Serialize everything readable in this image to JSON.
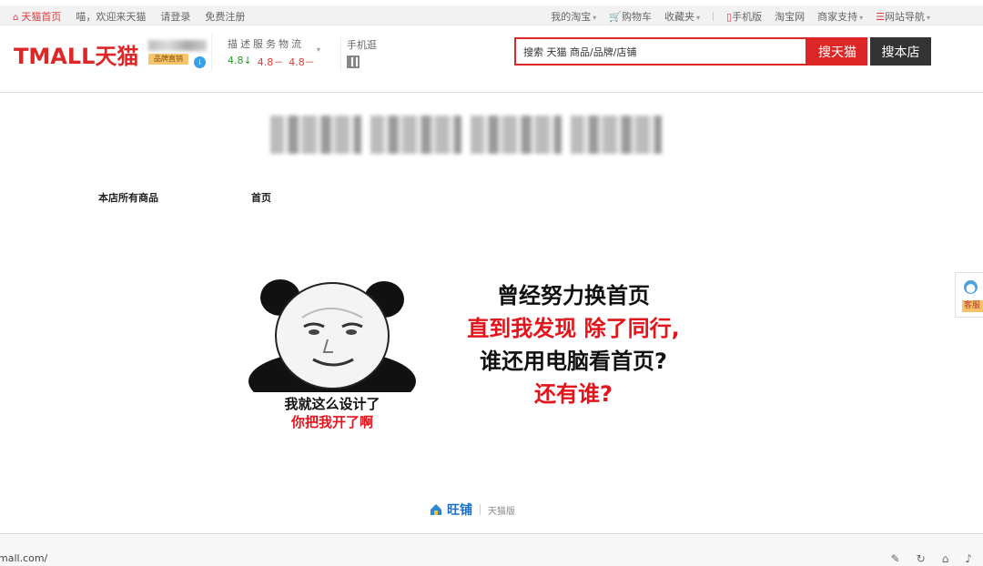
{
  "topnav": {
    "home": "天猫首页",
    "welcome": "喵，欢迎来天猫",
    "login": "请登录",
    "register": "免费注册",
    "my_taobao": "我的淘宝",
    "cart": "购物车",
    "favorites": "收藏夹",
    "mobile": "手机版",
    "taobao": "淘宝网",
    "merchant": "商家支持",
    "site_nav": "网站导航"
  },
  "header": {
    "logo": "TMALL天猫",
    "brand_badge": "品牌直销",
    "rating_labels": "描述服务物流",
    "ratings": [
      "4.8↓",
      "4.8－",
      "4.8－"
    ],
    "mobile_shop": "手机逛"
  },
  "search": {
    "value": "搜索 天猫 商品/品牌/店铺",
    "btn_tmall": "搜天猫",
    "btn_shop": "搜本店"
  },
  "shopnav": {
    "all_items": "本店所有商品",
    "home": "首页"
  },
  "meme": {
    "caption_line1": "我就这么设计了",
    "caption_line2": "你把我开了啊",
    "line1": "曾经努力换首页",
    "line2": "直到我发现 除了同行,",
    "line3": "谁还用电脑看首页?",
    "line4": "还有谁?"
  },
  "footer": {
    "wangpu": "旺铺",
    "version": "天猫版"
  },
  "service": {
    "label": "客服"
  },
  "statusbar": {
    "url": "mall.com/"
  },
  "colors": {
    "accent": "#dd2727",
    "dark_button": "#333333"
  }
}
